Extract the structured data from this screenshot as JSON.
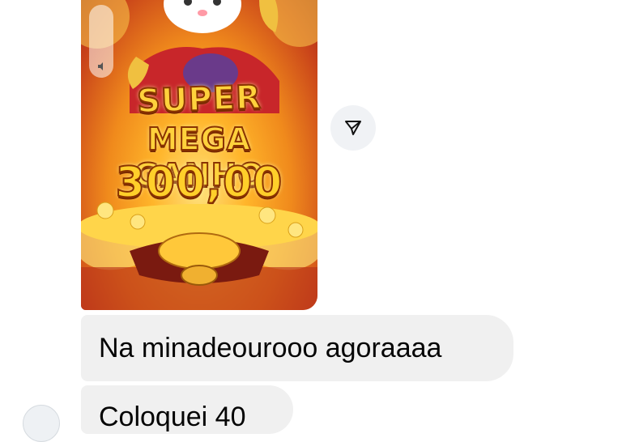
{
  "media": {
    "game_title_line1": "SUPER",
    "game_title_line2": "MEGA GANHO",
    "win_amount": "300,00",
    "volume_icon": "speaker-icon",
    "colors": {
      "gold": "#ffd23c",
      "outline": "#8a3300",
      "red": "#c8421a"
    }
  },
  "actions": {
    "share_icon": "send-icon"
  },
  "messages": [
    {
      "text": "Na minadeourooo agoraaaa"
    },
    {
      "text": "Coloquei 40"
    }
  ],
  "colors": {
    "bubble": "#f0f0f0",
    "send_button_bg": "#f0f2f5"
  }
}
